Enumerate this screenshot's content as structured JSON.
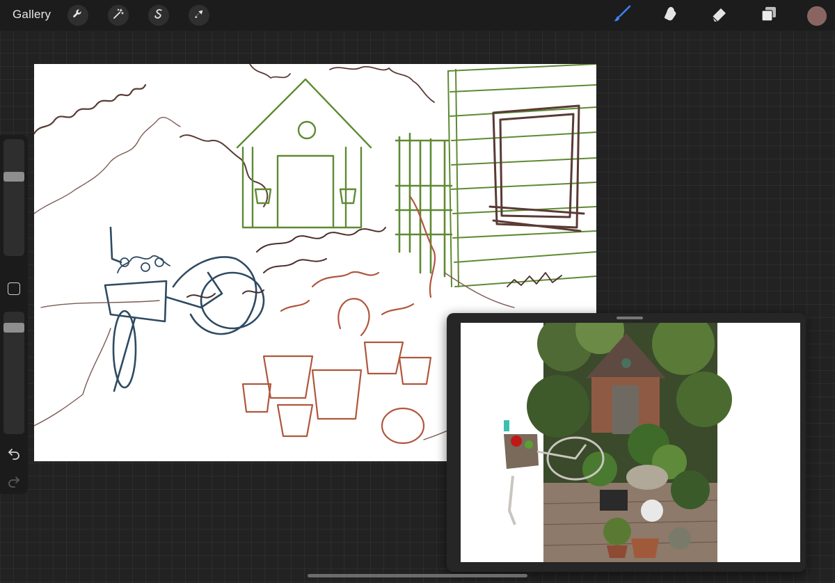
{
  "topbar": {
    "gallery_label": "Gallery",
    "left_tools": [
      "wrench-icon",
      "magic-wand-icon",
      "selection-icon",
      "transform-arrow-icon"
    ],
    "right_tools": [
      "brush-icon",
      "smudge-icon",
      "eraser-icon",
      "layers-icon"
    ],
    "active_tool": "brush",
    "active_tool_color": "#3b82f6",
    "current_color": "#8a6460"
  },
  "sidebar": {
    "brush_size_level": 0.35,
    "opacity_level": 0.1
  },
  "colors": {
    "sketch_brown": "#5a3a34",
    "sketch_green": "#5e8a32",
    "sketch_blue": "#2e4a62",
    "sketch_rust": "#b0563c"
  }
}
